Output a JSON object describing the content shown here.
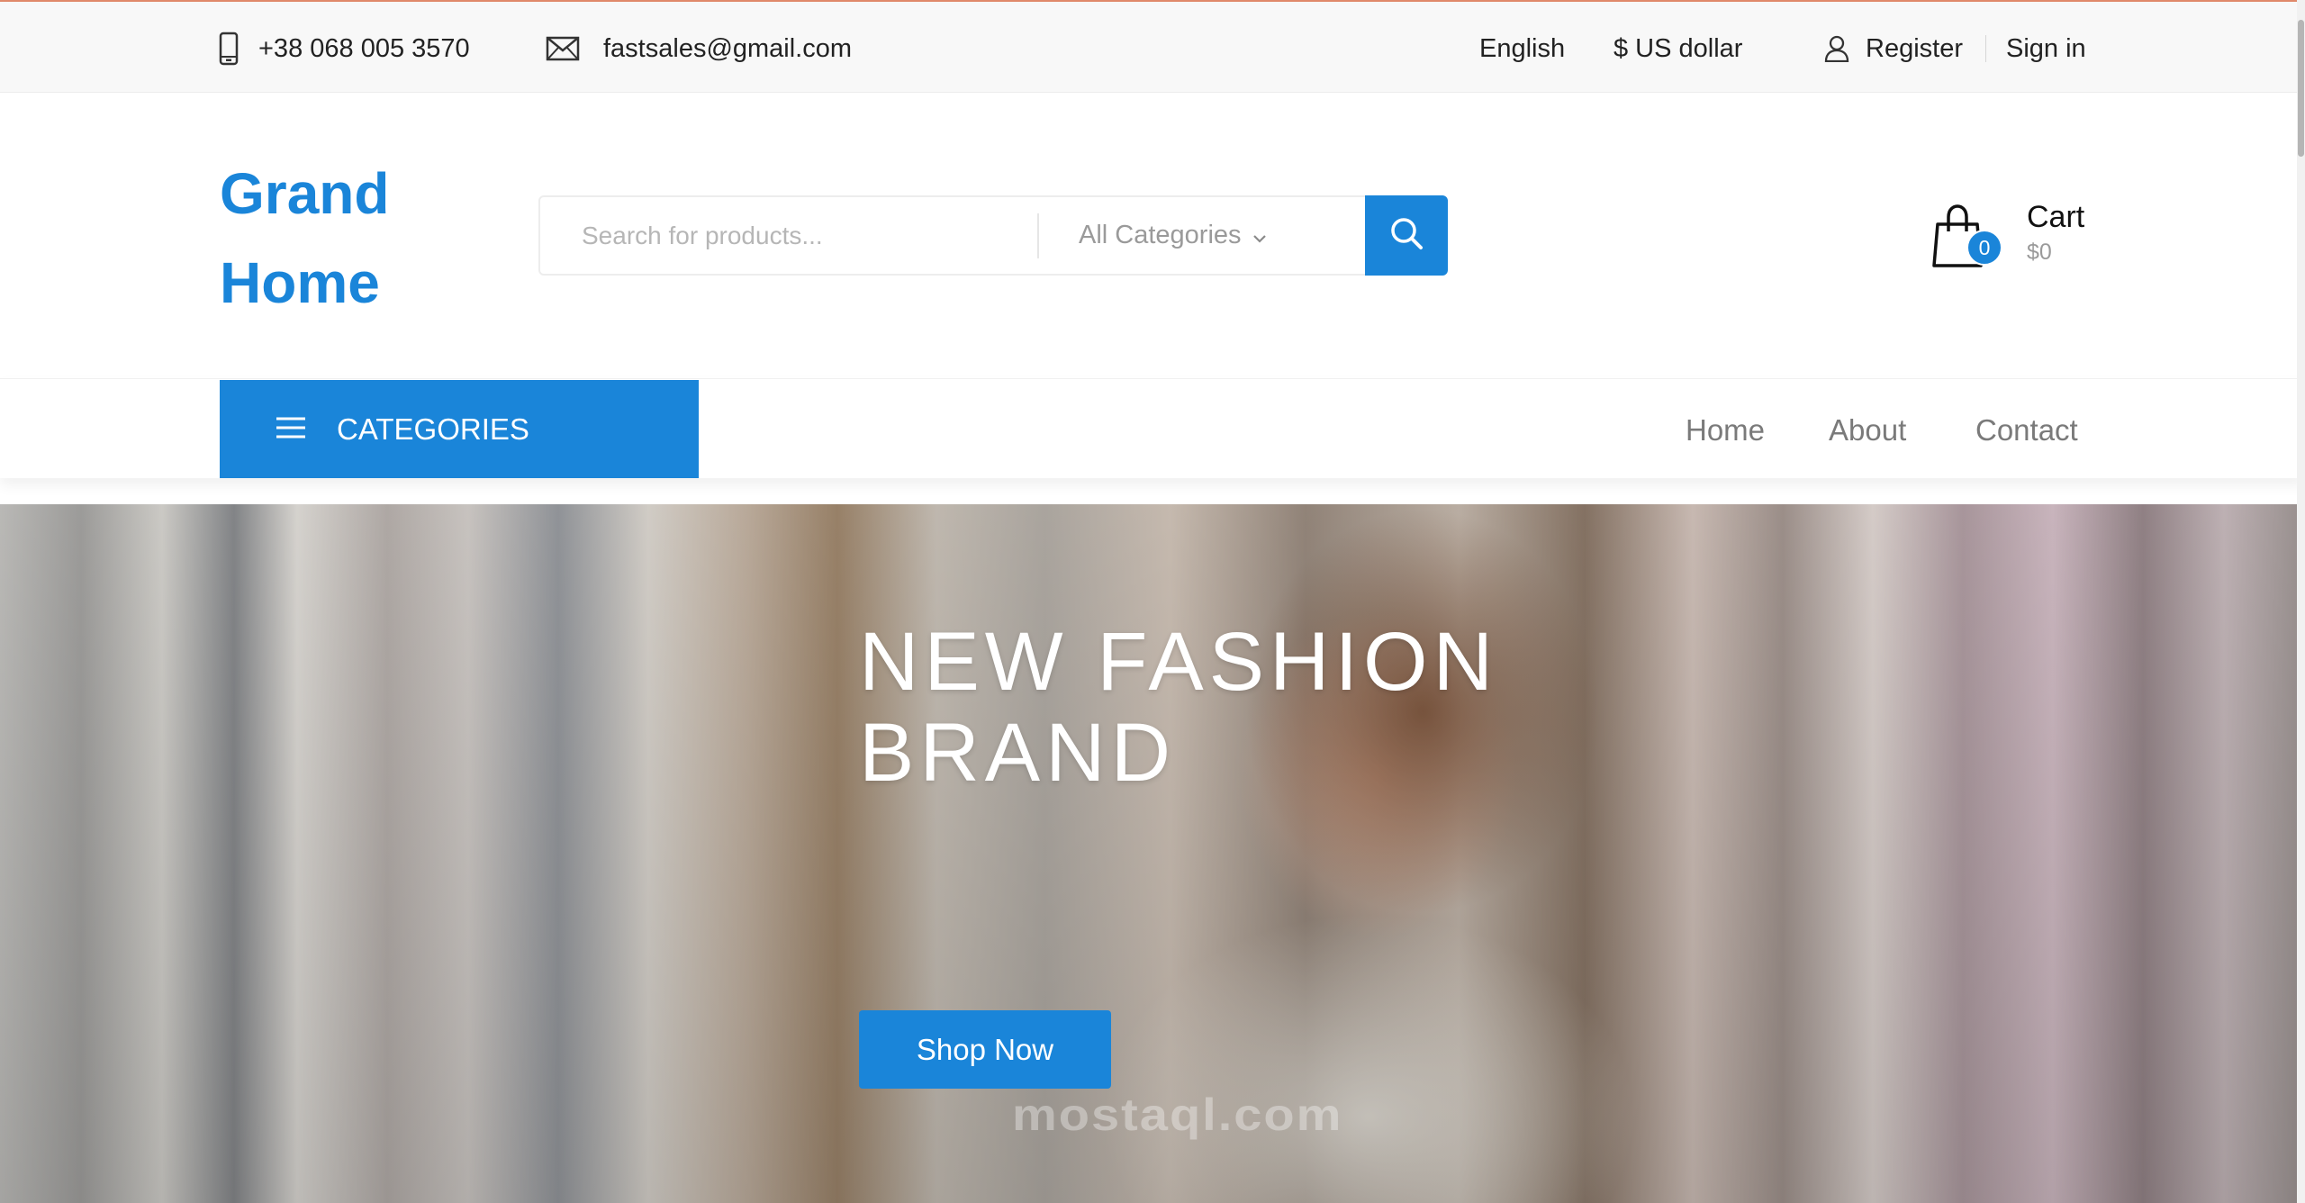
{
  "topbar": {
    "phone": "+38 068 005 3570",
    "email": "fastsales@gmail.com",
    "language": "English",
    "currency": "$ US dollar",
    "register": "Register",
    "sign_in": "Sign in",
    "accent_color": "#e0896a"
  },
  "header": {
    "logo_line1": "Grand",
    "logo_line2": "Home",
    "search_placeholder": "Search for products...",
    "search_category": "All Categories",
    "cart_label": "Cart",
    "cart_total": "$0",
    "cart_count": "0",
    "brand_color": "#1a85d9"
  },
  "nav": {
    "categories_label": "CATEGORIES",
    "links": [
      "Home",
      "About",
      "Contact"
    ]
  },
  "hero": {
    "title_line1": "NEW FASHION",
    "title_line2": "BRAND",
    "cta": "Shop Now",
    "watermark": "mostaql.com"
  },
  "icons": {
    "phone": "phone-icon",
    "email": "mail-icon",
    "user": "user-icon",
    "search": "search-icon",
    "cart": "shopping-bag-icon",
    "menu": "hamburger-icon",
    "dropdown": "chevron-down-icon"
  }
}
